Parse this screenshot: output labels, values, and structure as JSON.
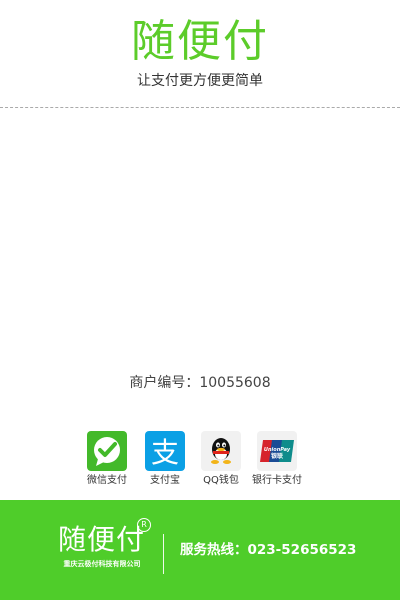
{
  "header": {
    "brand": "随便付",
    "slogan": "让支付更方便更简单"
  },
  "merchant": {
    "text": "商户编号：10055608"
  },
  "payment_methods": [
    {
      "label": "微信支付",
      "icon": "wechat-pay-icon",
      "color": "#43b92a"
    },
    {
      "label": "支付宝",
      "icon": "alipay-icon",
      "color": "#0ba0e5"
    },
    {
      "label": "QQ钱包",
      "icon": "qq-wallet-icon",
      "color": "#f1f1f1"
    },
    {
      "label": "银行卡支付",
      "icon": "unionpay-icon",
      "color": "#f1f1f1"
    }
  ],
  "footer": {
    "brand": "随便付",
    "registered_mark": "R",
    "company": "重庆云极付科技有限公司",
    "hotline": "服务热线：023-52656523"
  },
  "colors": {
    "brand_green": "#5ccc2a",
    "footer_green": "#4fcd2a",
    "text_dark": "#333333"
  }
}
